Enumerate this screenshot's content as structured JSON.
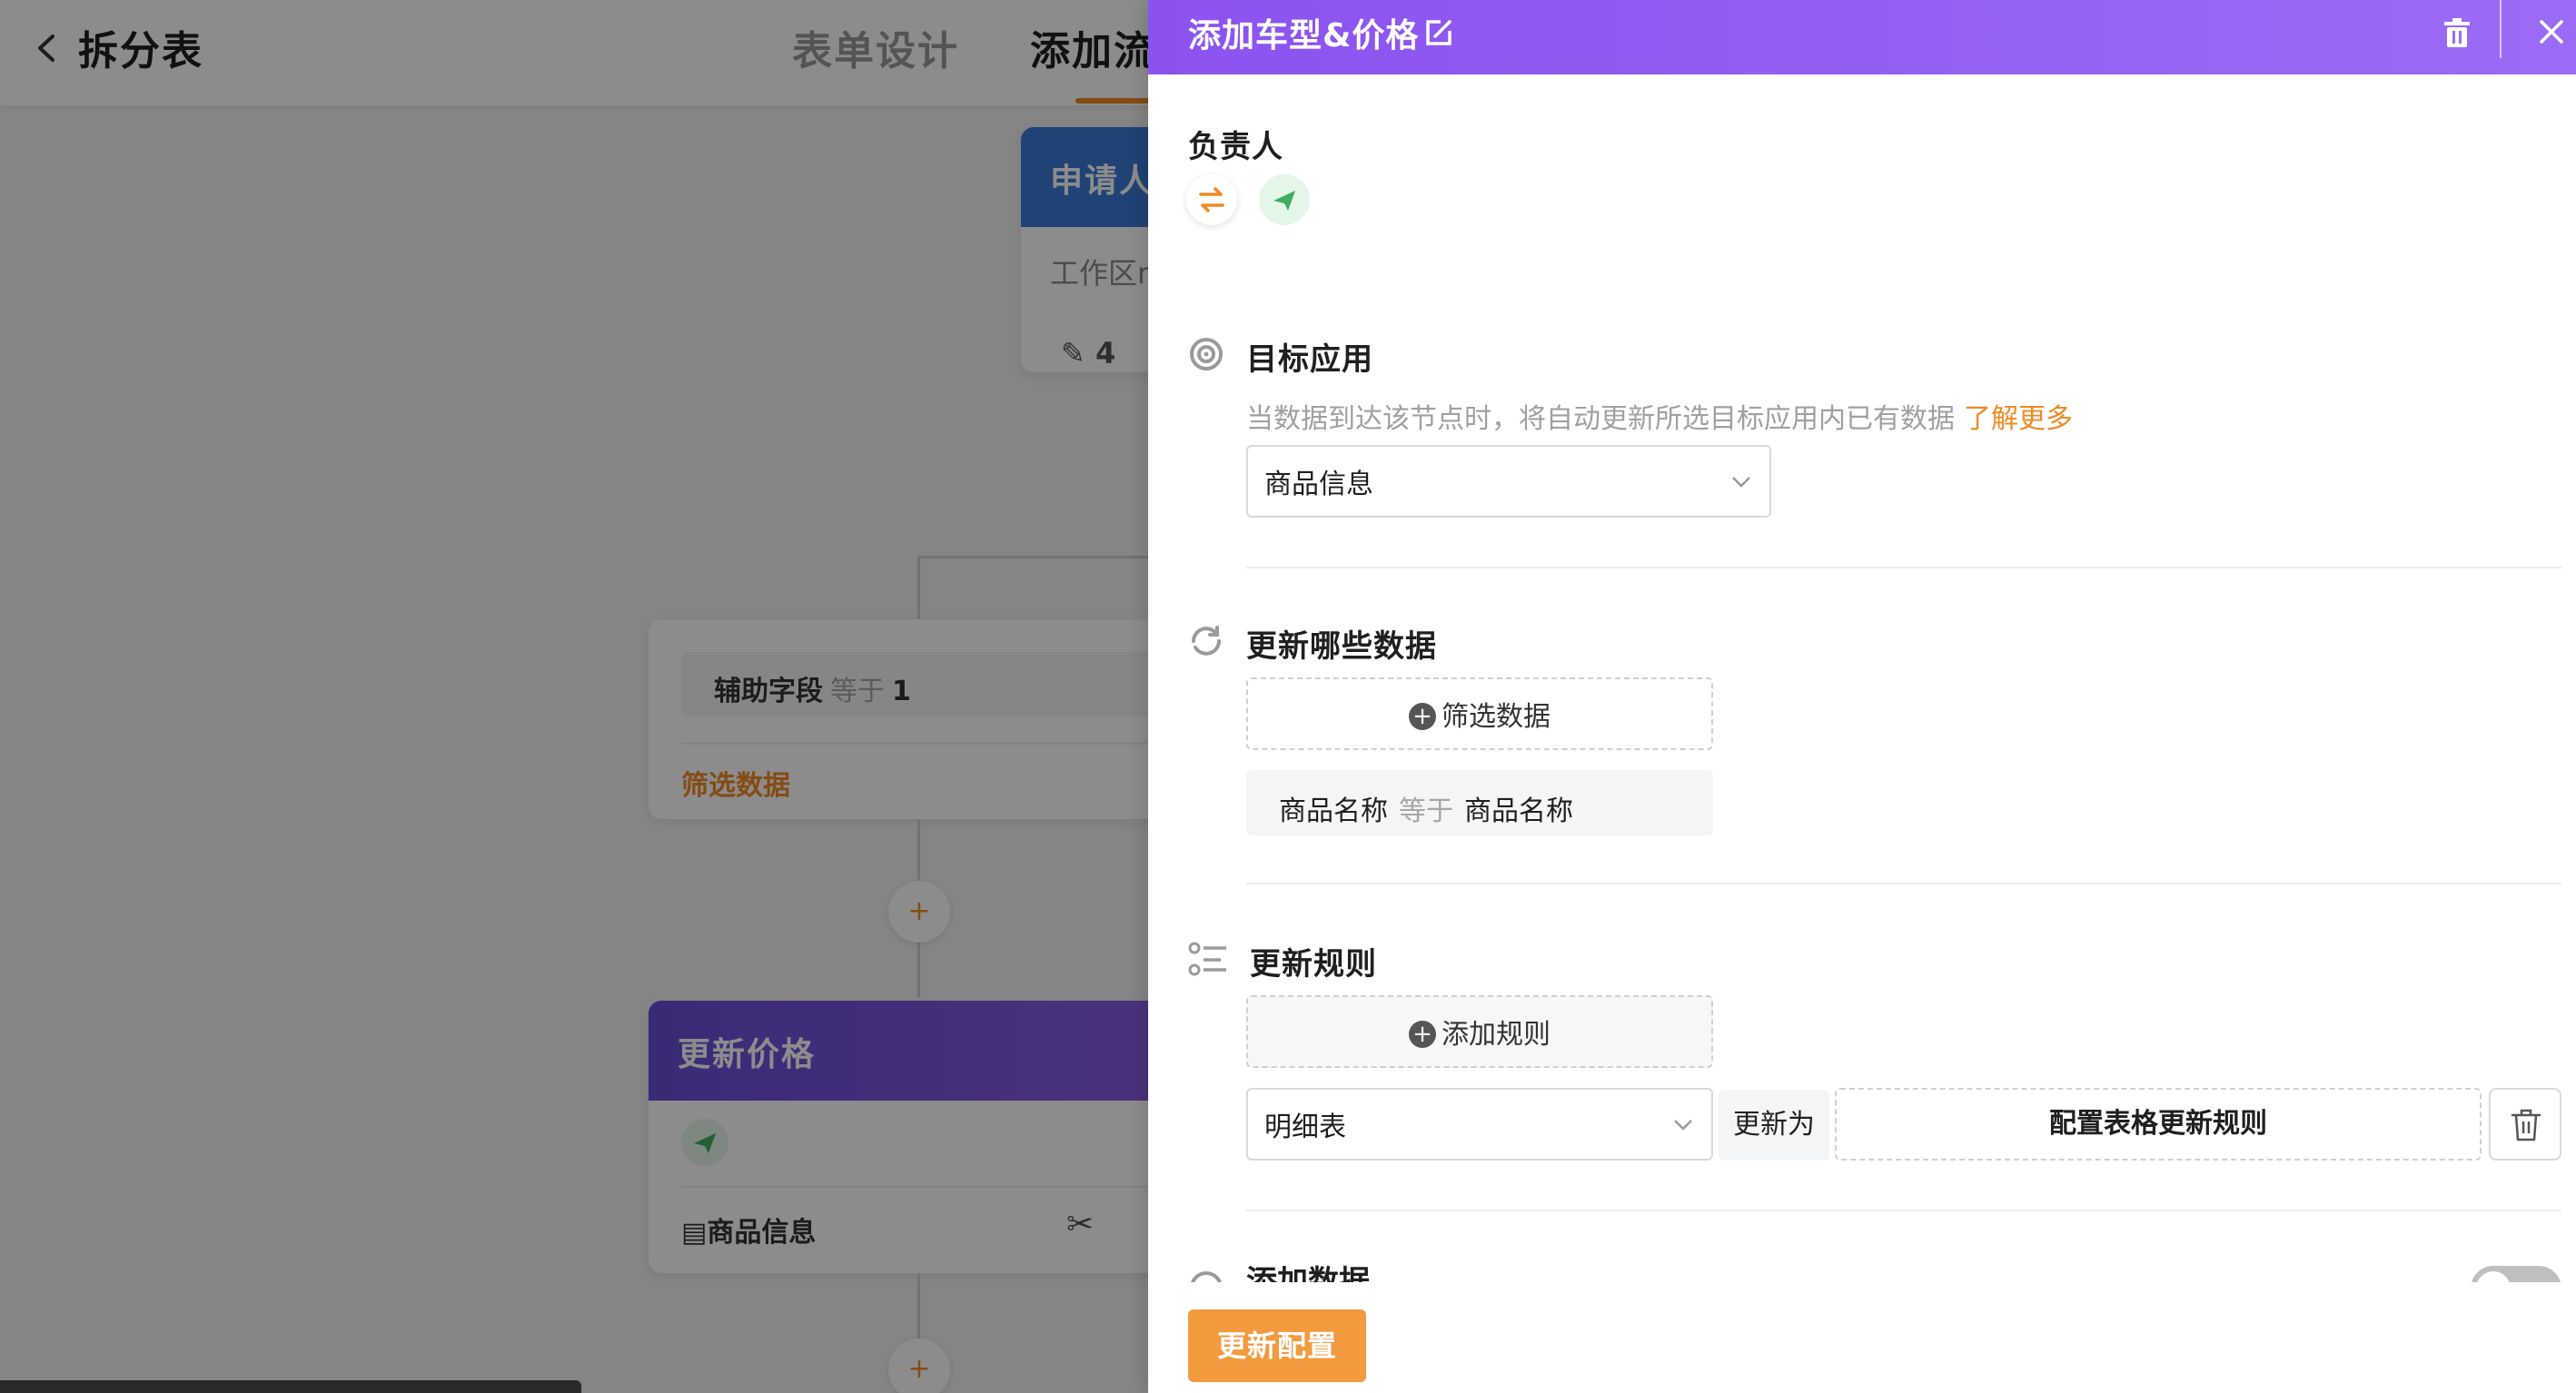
{
  "header": {
    "back_icon": "chevron-left-icon",
    "title": "拆分表",
    "tabs": [
      {
        "label": "表单设计"
      },
      {
        "label": "添加流"
      }
    ],
    "accent_color": "#f08a24"
  },
  "canvas": {
    "applicant_card": {
      "title": "申请人",
      "body": "工作区r",
      "stat": "4"
    },
    "filter_card": {
      "field": "辅助字段",
      "operator": "等于",
      "value": "1",
      "link": "筛选数据"
    },
    "update_card": {
      "title": "更新价格",
      "footer_label": "商品信息"
    },
    "add_node_symbol": "+"
  },
  "drawer": {
    "title": "添加车型&价格",
    "header_color": "#8b52f0",
    "owner": {
      "label": "负责人",
      "icons": [
        "swap-icon",
        "send-icon"
      ]
    },
    "target_app": {
      "title": "目标应用",
      "hint": "当数据到达该节点时，将自动更新所选目标应用内已有数据",
      "hint_link": "了解更多",
      "selected": "商品信息"
    },
    "update_which": {
      "title": "更新哪些数据",
      "filter_button": "筛选数据",
      "condition": {
        "field": "商品名称",
        "operator": "等于",
        "value": "商品名称"
      }
    },
    "update_rules": {
      "title": "更新规则",
      "add_button": "添加规则",
      "rule": {
        "table": "明细表",
        "update_to": "更新为",
        "config": "配置表格更新规则"
      }
    },
    "add_data": {
      "title": "添加数据"
    },
    "footer": {
      "primary": "更新配置",
      "primary_color": "#f39a3f"
    }
  }
}
